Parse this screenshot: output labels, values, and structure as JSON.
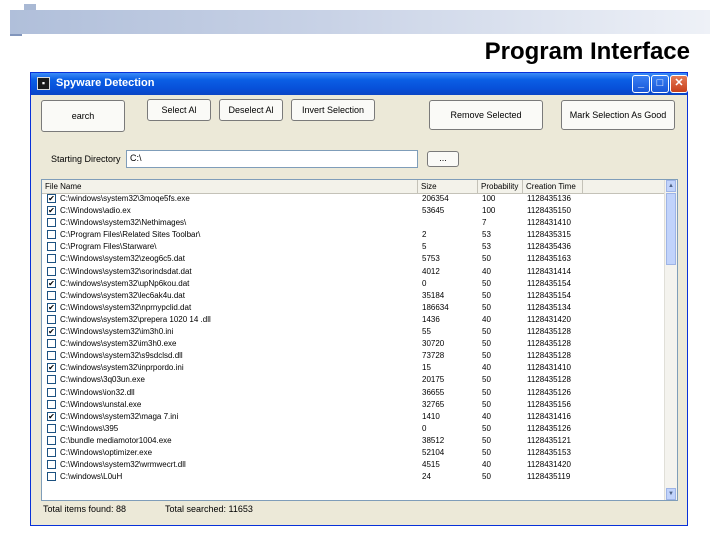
{
  "slide": {
    "title": "Program Interface"
  },
  "window": {
    "title": "Spyware Detection",
    "icon_name": "app-icon",
    "controls": {
      "minimize": "_",
      "maximize": "□",
      "close": "✕"
    }
  },
  "toolbar": {
    "search_label": "earch",
    "select_all_label": "Select Al",
    "deselect_all_label": "Deselect Al",
    "invert_selection_label": "Invert Selection",
    "remove_selected_label": "Remove Selected",
    "mark_selection_label": "Mark Selection As Good"
  },
  "directory": {
    "label": "Starting Directory",
    "value": "C:\\",
    "browse_label": "..."
  },
  "list": {
    "columns": [
      "File Name",
      "Size",
      "Probability",
      "Creation Time"
    ],
    "rows": [
      {
        "checked": true,
        "name": "C:\\windows\\system32\\3moqe5fs.exe",
        "size": "206354",
        "prob": "100",
        "time": "1128435136"
      },
      {
        "checked": true,
        "name": "C:\\Windows\\adio.ex",
        "size": "53645",
        "prob": "100",
        "time": "1128435150"
      },
      {
        "checked": false,
        "name": "C:\\Windows\\system32\\Nethimages\\",
        "size": "",
        "prob": "7",
        "time": "1128431410"
      },
      {
        "checked": false,
        "name": "C:\\Program Files\\Related Sites Toolbar\\",
        "size": "2",
        "prob": "53",
        "time": "1128435315"
      },
      {
        "checked": false,
        "name": "C:\\Program Files\\Starware\\",
        "size": "5",
        "prob": "53",
        "time": "1128435436"
      },
      {
        "checked": false,
        "name": "C:\\Windows\\system32\\zeog6c5.dat",
        "size": "5753",
        "prob": "50",
        "time": "1128435163"
      },
      {
        "checked": false,
        "name": "C:\\Windows\\system32\\sorindsdat.dat",
        "size": "4012",
        "prob": "40",
        "time": "1128431414"
      },
      {
        "checked": true,
        "name": "C:\\windows\\system32\\upNp6kou.dat",
        "size": "0",
        "prob": "50",
        "time": "1128435154"
      },
      {
        "checked": false,
        "name": "C:\\windows\\system32\\lec6ak4u.dat",
        "size": "35184",
        "prob": "50",
        "time": "1128435154"
      },
      {
        "checked": true,
        "name": "C:\\Windows\\system32\\nprnypclid.dat",
        "size": "186634",
        "prob": "50",
        "time": "1128435134"
      },
      {
        "checked": false,
        "name": "C:\\windows\\system32\\prepera 1020 14 .dll",
        "size": "1436",
        "prob": "40",
        "time": "1128431420"
      },
      {
        "checked": true,
        "name": "C:\\Windows\\system32\\im3h0.ini",
        "size": "55",
        "prob": "50",
        "time": "1128435128"
      },
      {
        "checked": false,
        "name": "C:\\windows\\system32\\im3h0.exe",
        "size": "30720",
        "prob": "50",
        "time": "1128435128"
      },
      {
        "checked": false,
        "name": "C:\\Windows\\system32\\s9sdclsd.dll",
        "size": "73728",
        "prob": "50",
        "time": "1128435128"
      },
      {
        "checked": true,
        "name": "C:\\windows\\system32\\inprpordo.ini",
        "size": "15",
        "prob": "40",
        "time": "1128431410"
      },
      {
        "checked": false,
        "name": "C:\\windows\\3q03un.exe",
        "size": "20175",
        "prob": "50",
        "time": "1128435128"
      },
      {
        "checked": false,
        "name": "C:\\Windows\\ion32.dll",
        "size": "36655",
        "prob": "50",
        "time": "1128435126"
      },
      {
        "checked": false,
        "name": "C:\\Windows\\unstal.exe",
        "size": "32765",
        "prob": "50",
        "time": "1128435156"
      },
      {
        "checked": true,
        "name": "C:\\Windows\\system32\\maga 7.ini",
        "size": "1410",
        "prob": "40",
        "time": "1128431416"
      },
      {
        "checked": false,
        "name": "C:\\Windows\\395",
        "size": "0",
        "prob": "50",
        "time": "1128435126"
      },
      {
        "checked": false,
        "name": "C:\\bundle mediamotor1004.exe",
        "size": "38512",
        "prob": "50",
        "time": "1128435121"
      },
      {
        "checked": false,
        "name": "C:\\Windows\\optimizer.exe",
        "size": "52104",
        "prob": "50",
        "time": "1128435153"
      },
      {
        "checked": false,
        "name": "C:\\Windows\\system32\\wrmwecrt.dll",
        "size": "4515",
        "prob": "40",
        "time": "1128431420"
      },
      {
        "checked": false,
        "name": "C:\\windows\\L0uH",
        "size": "24",
        "prob": "50",
        "time": "1128435119"
      }
    ]
  },
  "status": {
    "found_text": "Total items found: 88",
    "searched_text": "Total searched: 11653"
  }
}
